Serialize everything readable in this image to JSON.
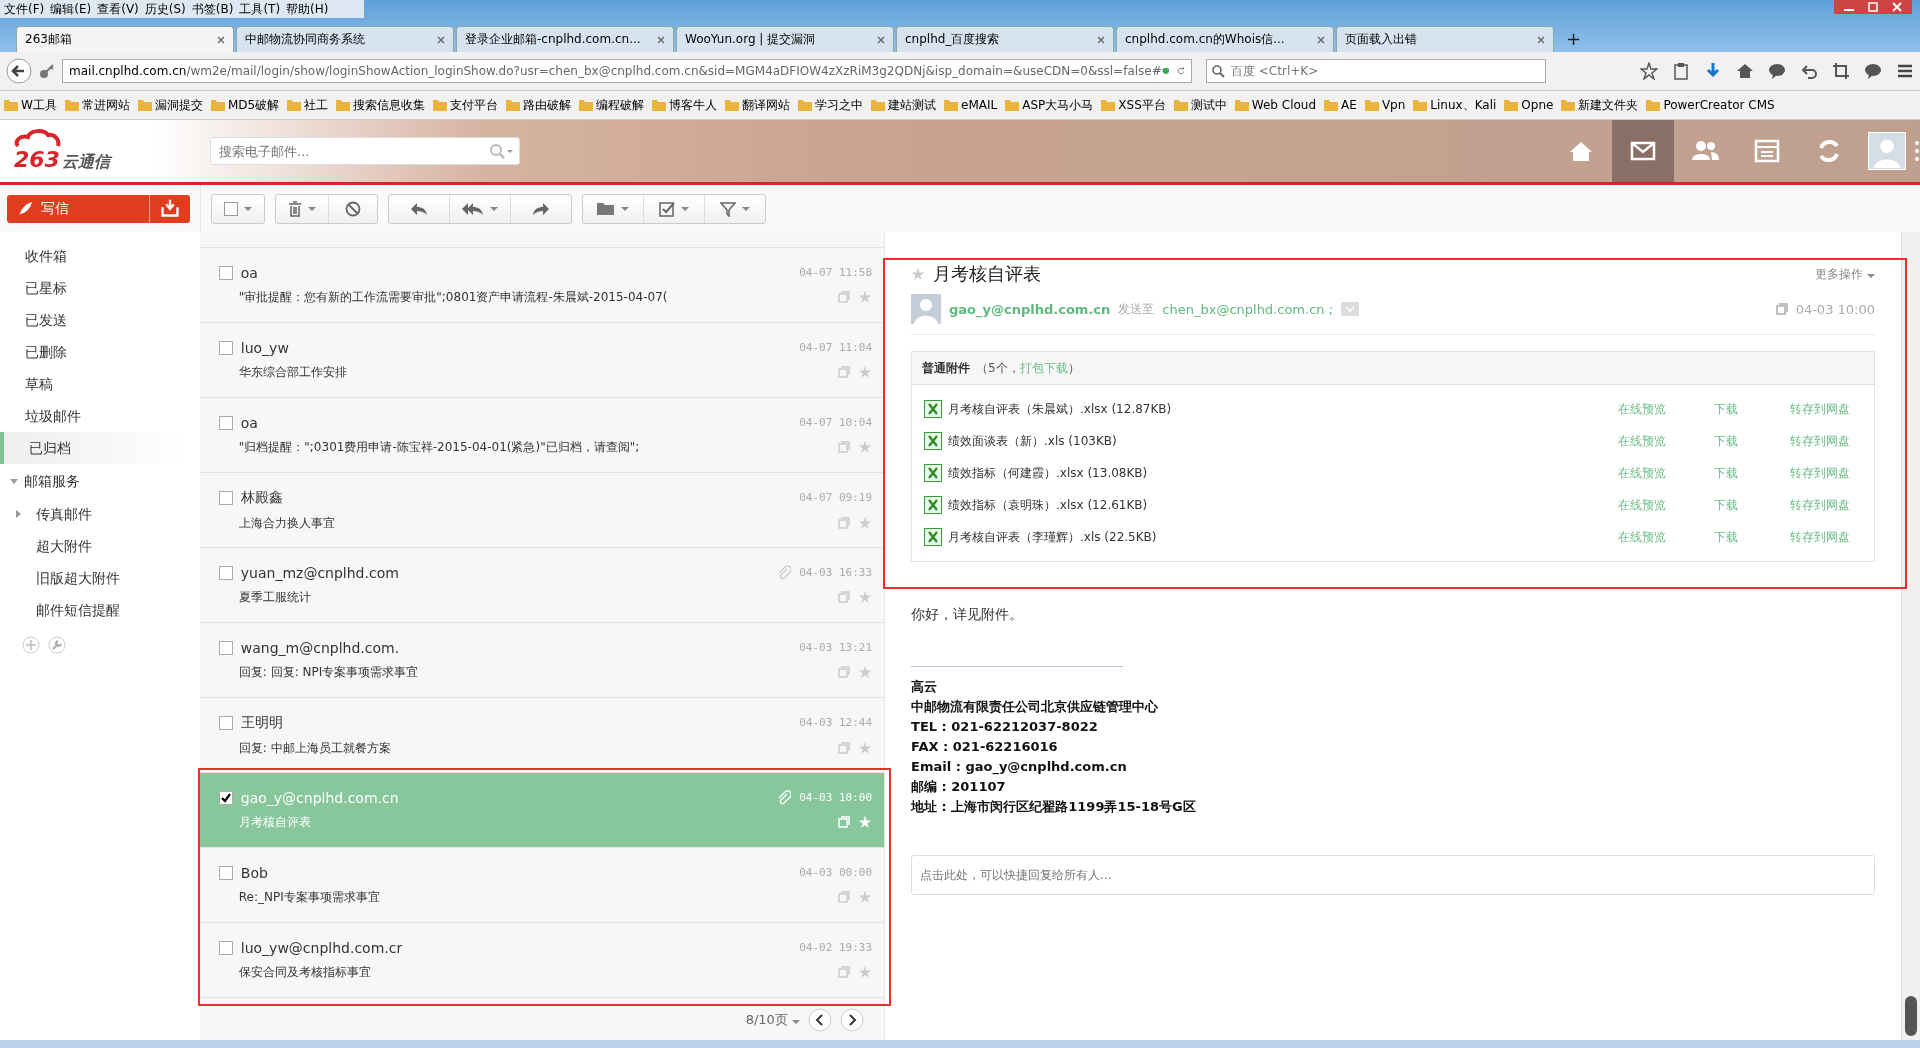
{
  "menu": [
    "文件(F)",
    "编辑(E)",
    "查看(V)",
    "历史(S)",
    "书签(B)",
    "工具(T)",
    "帮助(H)"
  ],
  "tabs": [
    {
      "title": "263邮箱",
      "selected": true
    },
    {
      "title": "中邮物流协同商务系统",
      "selected": false
    },
    {
      "title": "登录企业邮箱-cnplhd.com.cn...",
      "selected": false
    },
    {
      "title": "WooYun.org | 提交漏洞",
      "selected": false
    },
    {
      "title": "cnplhd_百度搜索",
      "selected": false
    },
    {
      "title": "cnplhd.com.cn的Whois信...",
      "selected": false
    },
    {
      "title": "页面载入出错",
      "selected": false
    }
  ],
  "new_tab": "+",
  "address": {
    "host": "mail.cnplhd.com.cn",
    "path": "/wm2e/mail/login/show/loginShowAction_loginShow.do?usr=chen_bx@cnplhd.com.cn&sid=MGM4aDFIOW4zXzRiM3g2QDNj&isp_domain=&useCDN=0&ssl=false#"
  },
  "web_search": {
    "placeholder": "百度 <Ctrl+K>"
  },
  "bookmarks": [
    "W工具",
    "常进网站",
    "漏洞提交",
    "MD5破解",
    "社工",
    "搜索信息收集",
    "支付平台",
    "路由破解",
    "编程破解",
    "博客牛人",
    "翻译网站",
    "学习之中",
    "建站测试",
    "eMAIL",
    "ASP大马小马",
    "XSS平台",
    "测试中",
    "Web Cloud",
    "AE",
    "Vpn",
    "Linux、Kali",
    "Opne",
    "新建文件夹",
    "PowerCreator CMS"
  ],
  "app": {
    "logo_number": "263",
    "logo_text": "云通信",
    "search": {
      "placeholder": "搜索电子邮件..."
    }
  },
  "compose": "写信",
  "select_all": {
    "checked": false
  },
  "folders": [
    {
      "label": "收件箱",
      "selected": false
    },
    {
      "label": "已星标",
      "selected": false
    },
    {
      "label": "已发送",
      "selected": false
    },
    {
      "label": "已删除",
      "selected": false
    },
    {
      "label": "草稿",
      "selected": false
    },
    {
      "label": "垃圾邮件",
      "selected": false
    },
    {
      "label": "已归档",
      "selected": true
    }
  ],
  "services": {
    "label": "邮箱服务",
    "expanded": true,
    "children": [
      {
        "label": "传真邮件",
        "kind": "group"
      },
      {
        "label": "超大附件",
        "kind": "leaf"
      },
      {
        "label": "旧版超大附件",
        "kind": "leaf"
      },
      {
        "label": "邮件短信提醒",
        "kind": "leaf"
      }
    ]
  },
  "messages": [
    {
      "sender": "oa",
      "subject": "\"审批提醒：您有新的工作流需要审批\";0801资产申请流程-朱晨斌-2015-04-07(",
      "time": "04-07 11:58",
      "attachment": false,
      "checked": false,
      "selected": false
    },
    {
      "sender": "luo_yw",
      "subject": "华东综合部工作安排",
      "time": "04-07 11:04",
      "attachment": false,
      "checked": false,
      "selected": false
    },
    {
      "sender": "oa",
      "subject": "\"归档提醒：\";0301费用申请-陈宝祥-2015-04-01(紧急)\"已归档，请查阅\";",
      "time": "04-07 10:04",
      "attachment": false,
      "checked": false,
      "selected": false
    },
    {
      "sender": "林殿鑫",
      "subject": "上海合力换人事宜",
      "time": "04-07 09:19",
      "attachment": false,
      "checked": false,
      "selected": false
    },
    {
      "sender": "yuan_mz@cnplhd.com",
      "subject": "夏季工服统计",
      "time": "04-03 16:33",
      "attachment": true,
      "checked": false,
      "selected": false
    },
    {
      "sender": "wang_m@cnplhd.com.",
      "subject": "回复: 回复: NPI专案事项需求事宜",
      "time": "04-03 13:21",
      "attachment": false,
      "checked": false,
      "selected": false
    },
    {
      "sender": "王明明",
      "subject": "回复: 中邮上海员工就餐方案",
      "time": "04-03 12:44",
      "attachment": false,
      "checked": false,
      "selected": false
    },
    {
      "sender": "gao_y@cnplhd.com.cn",
      "subject": "月考核自评表",
      "time": "04-03 10:00",
      "attachment": true,
      "checked": true,
      "selected": true
    },
    {
      "sender": "Bob",
      "subject": "Re:_NPI专案事项需求事宜",
      "time": "04-03 00:00",
      "attachment": false,
      "checked": false,
      "selected": false
    },
    {
      "sender": "luo_yw@cnplhd.com.cr",
      "subject": "保安合同及考核指标事宜",
      "time": "04-02 19:33",
      "attachment": false,
      "checked": false,
      "selected": false
    }
  ],
  "pager": "8/10页",
  "reader": {
    "subject": "月考核自评表",
    "more": "更多操作",
    "from": "gao_y@cnplhd.com.cn",
    "sent_to_label": "发送至",
    "to": "chen_bx@cnplhd.com.cn ;",
    "time": "04-03 10:00",
    "attachments": {
      "title": "普通附件",
      "count": "（5个，",
      "download_all": "打包下载",
      "close": "）",
      "files": [
        {
          "name": "月考核自评表（朱晨斌）.xlsx (12.87KB)",
          "preview": "在线预览",
          "download": "下载",
          "save": "转存到网盘"
        },
        {
          "name": "绩效面谈表（新）.xls (103KB)",
          "preview": "在线预览",
          "download": "下载",
          "save": "转存到网盘"
        },
        {
          "name": "绩效指标（何建霞）.xlsx (13.08KB)",
          "preview": "在线预览",
          "download": "下载",
          "save": "转存到网盘"
        },
        {
          "name": "绩效指标（袁明珠）.xlsx (12.61KB)",
          "preview": "在线预览",
          "download": "下载",
          "save": "转存到网盘"
        },
        {
          "name": "月考核自评表（李瑾辉）.xls (22.5KB)",
          "preview": "在线预览",
          "download": "下载",
          "save": "转存到网盘"
        }
      ]
    },
    "body": "你好，详见附件。",
    "signature": [
      "高云",
      "中邮物流有限责任公司北京供应链管理中心",
      "TEL : 021-62212037-8022",
      "FAX : 021-62216016",
      "Email : gao_y@cnplhd.com.cn",
      "邮编 : 201107",
      "地址 : 上海市闵行区纪翟路1199弄15-18号G区"
    ],
    "reply": {
      "placeholder": "点击此处，可以快捷回复给所有人..."
    }
  }
}
